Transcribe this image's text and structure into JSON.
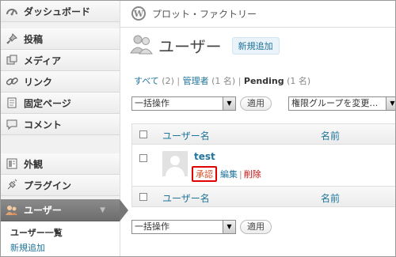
{
  "sidebar": {
    "items": [
      {
        "label": "ダッシュボード",
        "icon": "dashboard-icon"
      },
      {
        "label": "投稿",
        "icon": "pushpin-icon"
      },
      {
        "label": "メディア",
        "icon": "media-icon"
      },
      {
        "label": "リンク",
        "icon": "link-icon"
      },
      {
        "label": "固定ページ",
        "icon": "page-icon"
      },
      {
        "label": "コメント",
        "icon": "comment-icon"
      },
      {
        "label": "外観",
        "icon": "appearance-icon"
      },
      {
        "label": "プラグイン",
        "icon": "plugin-icon"
      },
      {
        "label": "ユーザー",
        "icon": "users-icon"
      }
    ],
    "submenu": [
      {
        "label": "ユーザー一覧"
      },
      {
        "label": "新規追加"
      }
    ]
  },
  "site": {
    "name": "プロット・ファクトリー"
  },
  "page": {
    "title": "ユーザー",
    "add_new": "新規追加"
  },
  "filters": {
    "all_label": "すべて",
    "all_count": "(2)",
    "admin_label": "管理者",
    "admin_count": "(1 名)",
    "pending_label": "Pending",
    "pending_count": "(1 名)",
    "sep": "|"
  },
  "bulk": {
    "select_value": "一括操作",
    "apply": "適用"
  },
  "role": {
    "select_value": "権限グループを変更…"
  },
  "table": {
    "col_user": "ユーザー名",
    "col_name": "名前",
    "rows": [
      {
        "username": "test",
        "approve": "承認",
        "edit": "編集",
        "delete": "削除",
        "sep": "|"
      }
    ]
  },
  "colors": {
    "accent": "#21759b",
    "delete": "#bc0b0b",
    "highlight": "#e00000"
  }
}
